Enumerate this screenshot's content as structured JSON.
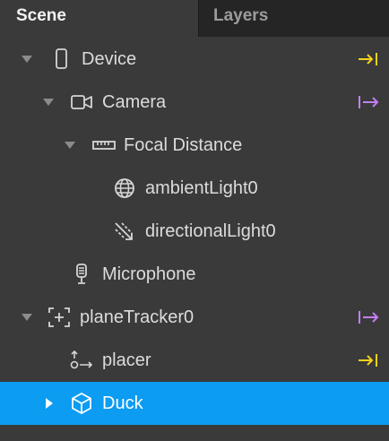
{
  "tabs": {
    "scene": "Scene",
    "layers": "Layers"
  },
  "tree": {
    "device": "Device",
    "camera": "Camera",
    "focal_distance": "Focal Distance",
    "ambient_light": "ambientLight0",
    "directional_light": "directionalLight0",
    "microphone": "Microphone",
    "plane_tracker": "planeTracker0",
    "placer": "placer",
    "duck": "Duck"
  },
  "icons": {
    "device": "phone-icon",
    "camera": "camera-icon",
    "focal_distance": "ruler-icon",
    "ambient_light": "globe-icon",
    "directional_light": "directional-light-icon",
    "microphone": "microphone-icon",
    "plane_tracker": "plane-tracker-icon",
    "placer": "null-object-icon",
    "duck": "cube-icon",
    "link_in": "arrow-to-bar-icon",
    "link_out": "bar-to-arrow-icon"
  },
  "colors": {
    "selection": "#0c9cf2",
    "link_yellow": "#f2d21c",
    "link_purple": "#c47ef5"
  }
}
